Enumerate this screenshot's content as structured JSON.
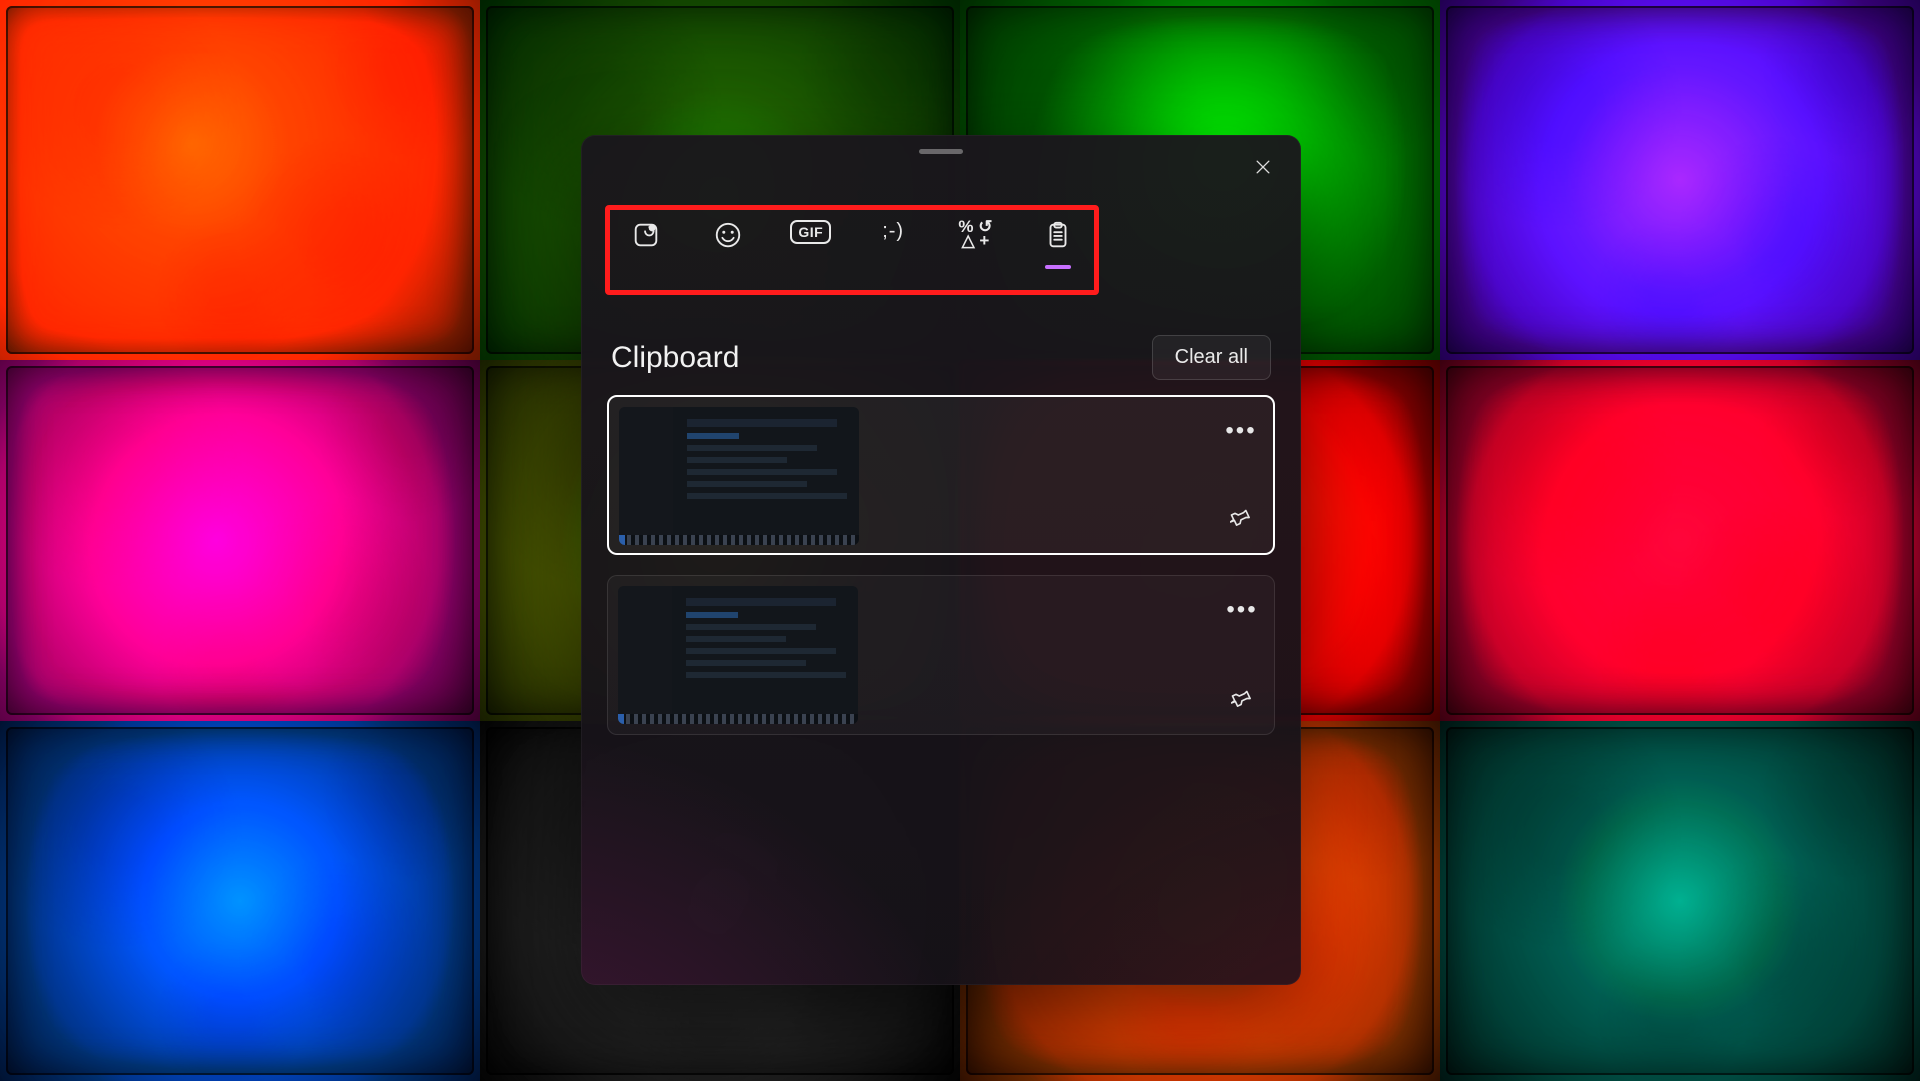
{
  "panel": {
    "section_title": "Clipboard",
    "clear_all_label": "Clear all",
    "tabs": [
      {
        "id": "recent",
        "name": "Recently used",
        "active": false
      },
      {
        "id": "emoji",
        "name": "Emoji",
        "active": false
      },
      {
        "id": "gif",
        "name": "GIF",
        "active": false,
        "label": "GIF"
      },
      {
        "id": "kaomoji",
        "name": "Kaomoji",
        "active": false,
        "label": ";-)"
      },
      {
        "id": "symbols",
        "name": "Symbols",
        "active": false
      },
      {
        "id": "clipboard",
        "name": "Clipboard history",
        "active": true
      }
    ],
    "items": [
      {
        "type": "image",
        "selected": true
      },
      {
        "type": "image",
        "selected": false
      }
    ]
  },
  "annotation": {
    "highlight_box_color": "#ff1c1c"
  }
}
